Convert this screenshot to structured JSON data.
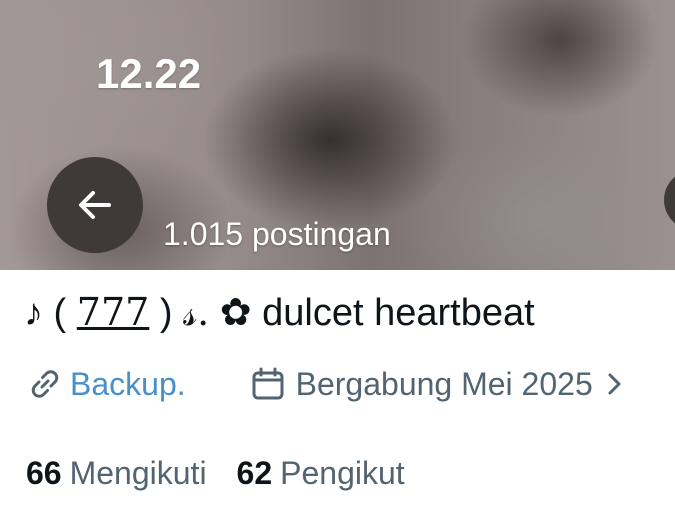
{
  "header": {
    "title": "12.22",
    "post_count": "1.015 postingan"
  },
  "profile": {
    "display_name_parts": {
      "prefix": "♪ ( ",
      "underlined": "777",
      "middle": " ) ",
      "script_s": "𝓈.",
      "suffix": " ✿ dulcet heartbeat"
    },
    "link_label": "Backup.",
    "joined_label": "Bergabung Mei 2025"
  },
  "stats": {
    "following_count": "66",
    "following_label": "Mengikuti",
    "followers_count": "62",
    "followers_label": "Pengikut"
  },
  "icons": {
    "back": "arrow-left-icon",
    "link": "link-icon",
    "calendar": "calendar-icon",
    "chevron": "chevron-right-icon"
  },
  "colors": {
    "link": "#4a90c8",
    "secondary_text": "#536471",
    "primary_text": "#0f1419",
    "button_bg": "#3f3938"
  }
}
